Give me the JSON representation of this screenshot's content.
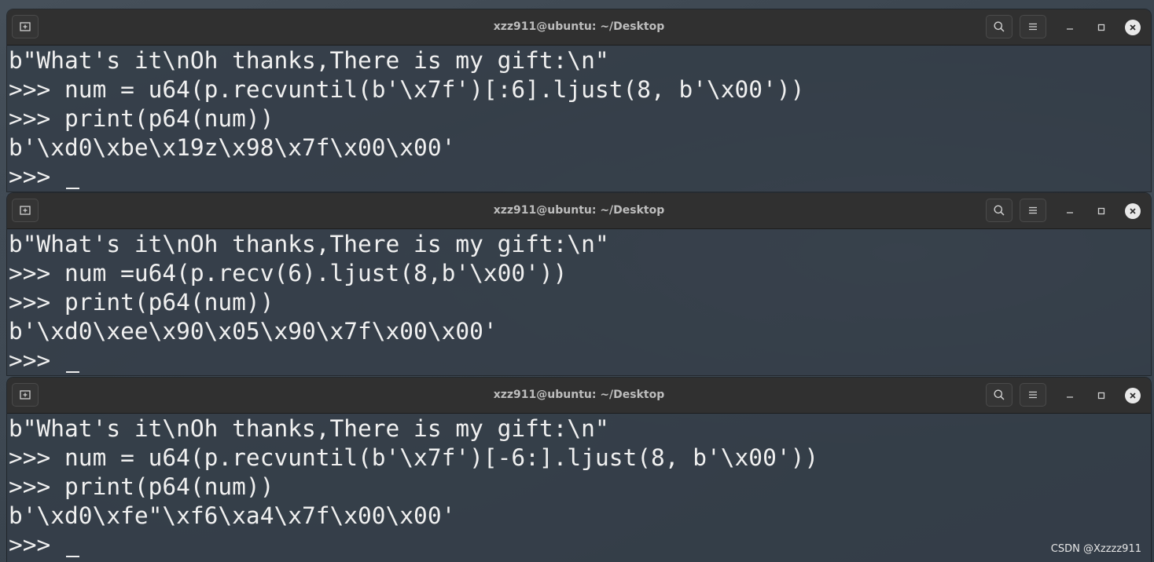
{
  "terminals": [
    {
      "title": "xzz911@ubuntu: ~/Desktop",
      "lines": [
        "b\"What's it\\nOh thanks,There is my gift:\\n\"",
        ">>> num = u64(p.recvuntil(b'\\x7f')[:6].ljust(8, b'\\x00'))",
        ">>> print(p64(num))",
        "b'\\xd0\\xbe\\x19z\\x98\\x7f\\x00\\x00'",
        ">>> "
      ]
    },
    {
      "title": "xzz911@ubuntu: ~/Desktop",
      "lines": [
        "b\"What's it\\nOh thanks,There is my gift:\\n\"",
        ">>> num =u64(p.recv(6).ljust(8,b'\\x00'))",
        ">>> print(p64(num))",
        "b'\\xd0\\xee\\x90\\x05\\x90\\x7f\\x00\\x00'",
        ">>> "
      ]
    },
    {
      "title": "xzz911@ubuntu: ~/Desktop",
      "lines": [
        "b\"What's it\\nOh thanks,There is my gift:\\n\"",
        ">>> num = u64(p.recvuntil(b'\\x7f')[-6:].ljust(8, b'\\x00'))",
        ">>> print(p64(num))",
        "b'\\xd0\\xfe\"\\xf6\\xa4\\x7f\\x00\\x00'",
        ">>> "
      ]
    }
  ],
  "watermark": "CSDN @Xzzzz911",
  "icons": {
    "new_tab": "new-tab-icon",
    "search": "search-icon",
    "menu": "hamburger-menu-icon",
    "minimize": "minimize-icon",
    "maximize": "maximize-icon",
    "close": "close-icon"
  },
  "colors": {
    "titlebar": "#303030",
    "terminal_bg": "#343e48",
    "text": "#f0f0f0",
    "title_text": "#bdbdbd"
  }
}
